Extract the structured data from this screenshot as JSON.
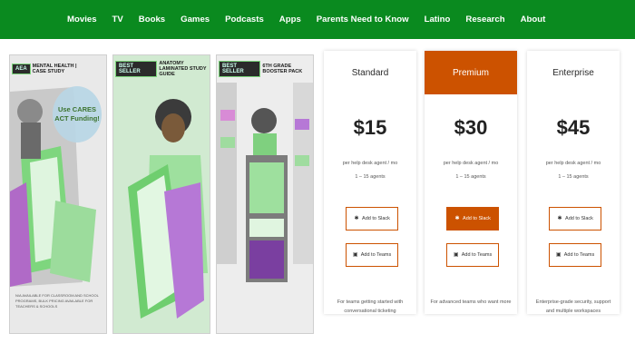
{
  "nav": {
    "items": [
      "Movies",
      "TV",
      "Books",
      "Games",
      "Podcasts",
      "Apps",
      "Parents Need to Know",
      "Latino",
      "Research",
      "About"
    ]
  },
  "products": [
    {
      "tag": "AEA",
      "title": "MENTAL HEALTH | CASE STUDY",
      "bubble": "Use CARES ACT Funding!",
      "fine": "N/A AVAILABLE FOR CLASSROOM AND SCHOOL PROGRAMS, BULK PRICING AVAILABLE FOR TEACHERS & SCHOOLS"
    },
    {
      "tag": "BEST SELLER",
      "title": "ANATOMY LAMINATED STUDY GUIDE",
      "bubble": "",
      "fine": ""
    },
    {
      "tag": "BEST SELLER",
      "title": "6TH GRADE BOOSTER PACK",
      "bubble": "",
      "fine": ""
    }
  ],
  "pricing": [
    {
      "name": "Standard",
      "price": "$15",
      "unit": "per help desk agent / mo",
      "agents": "1 – 15 agents",
      "slack_label": "Add to Slack",
      "teams_label": "Add to Teams",
      "description": "For teams getting started with conversational ticketing"
    },
    {
      "name": "Premium",
      "price": "$30",
      "unit": "per help desk agent / mo",
      "agents": "1 – 15 agents",
      "slack_label": "Add to Slack",
      "teams_label": "Add to Teams",
      "description": "For advanced teams who want more"
    },
    {
      "name": "Enterprise",
      "price": "$45",
      "unit": "per help desk agent / mo",
      "agents": "1 – 15 agents",
      "slack_label": "Add to Slack",
      "teams_label": "Add to Teams",
      "description": "Enterprise-grade security, support and multiple workspaces"
    }
  ],
  "colors": {
    "nav_bg": "#0a8a1f",
    "accent": "#cc5200"
  }
}
